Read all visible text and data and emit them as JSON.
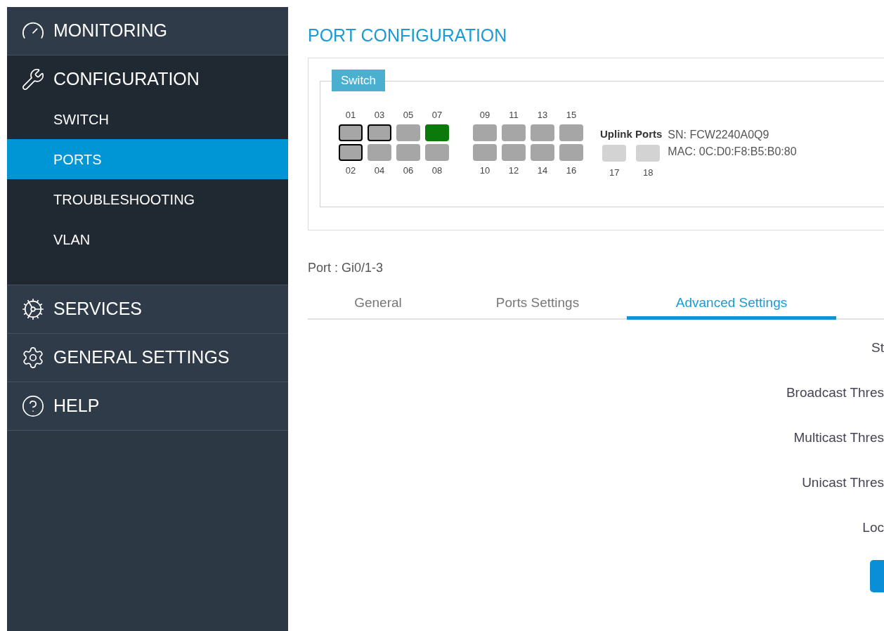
{
  "sidebar": {
    "sections": [
      {
        "label": "MONITORING",
        "expanded": false
      },
      {
        "label": "CONFIGURATION",
        "expanded": true,
        "items": [
          {
            "label": "SWITCH",
            "selected": false
          },
          {
            "label": "PORTS",
            "selected": true
          },
          {
            "label": "TROUBLESHOOTING",
            "selected": false
          },
          {
            "label": "VLAN",
            "selected": false
          }
        ]
      },
      {
        "label": "SERVICES",
        "expanded": false
      },
      {
        "label": "GENERAL SETTINGS",
        "expanded": false
      },
      {
        "label": "HELP",
        "expanded": false
      }
    ]
  },
  "page_title": "PORT CONFIGURATION",
  "switch_panel": {
    "legend": "Switch",
    "port_groups": [
      {
        "ports": [
          {
            "label": "01",
            "selected": true,
            "color": "#a6a6a6"
          },
          {
            "label": "02",
            "selected": true,
            "color": "#a6a6a6"
          },
          {
            "label": "03",
            "selected": true,
            "color": "#a6a6a6"
          },
          {
            "label": "04",
            "selected": false,
            "color": "#a6a6a6"
          },
          {
            "label": "05",
            "selected": false,
            "color": "#a6a6a6"
          },
          {
            "label": "06",
            "selected": false,
            "color": "#a6a6a6"
          },
          {
            "label": "07",
            "selected": false,
            "color": "#0b7a0b"
          },
          {
            "label": "08",
            "selected": false,
            "color": "#a6a6a6"
          }
        ]
      },
      {
        "ports": [
          {
            "label": "09",
            "selected": false,
            "color": "#a6a6a6"
          },
          {
            "label": "10",
            "selected": false,
            "color": "#a6a6a6"
          },
          {
            "label": "11",
            "selected": false,
            "color": "#a6a6a6"
          },
          {
            "label": "12",
            "selected": false,
            "color": "#a6a6a6"
          },
          {
            "label": "13",
            "selected": false,
            "color": "#a6a6a6"
          },
          {
            "label": "14",
            "selected": false,
            "color": "#a6a6a6"
          },
          {
            "label": "15",
            "selected": false,
            "color": "#a6a6a6"
          },
          {
            "label": "16",
            "selected": false,
            "color": "#a6a6a6"
          }
        ]
      }
    ],
    "uplink": {
      "title": "Uplink Ports",
      "ports": [
        {
          "label": "17",
          "selected": false,
          "color": "#d3d3d3"
        },
        {
          "label": "18",
          "selected": false,
          "color": "#d3d3d3"
        }
      ]
    },
    "info": [
      "SN: FCW2240A0Q9",
      "MAC: 0C:D0:F8:B5:B0:80"
    ]
  },
  "port_label": "Port : Gi0/1-3",
  "tabs": [
    {
      "label": "General",
      "selected": false
    },
    {
      "label": "Ports Settings",
      "selected": false
    },
    {
      "label": "Advanced Settings",
      "selected": true
    }
  ],
  "form_labels": [
    "St",
    "Broadcast Thres",
    "Multicast Thres",
    "Unicast Thres",
    "Loc"
  ]
}
